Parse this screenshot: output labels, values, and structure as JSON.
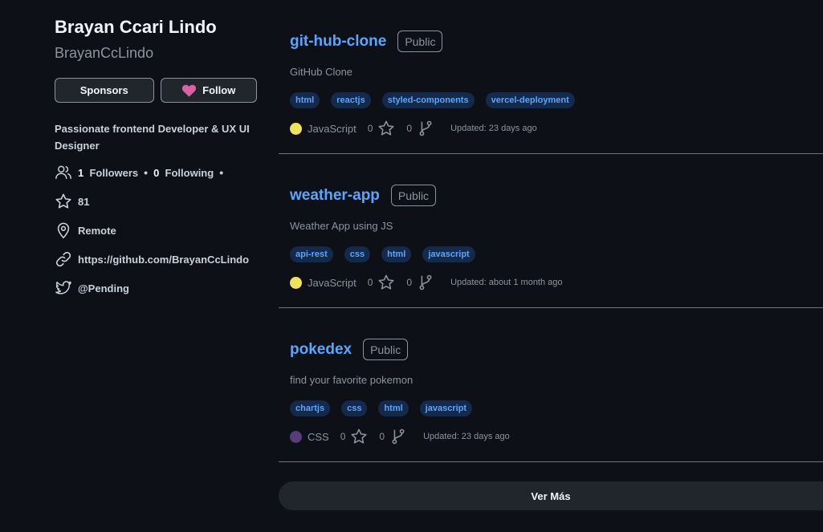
{
  "profile": {
    "name": "Brayan Ccari Lindo",
    "login": "BrayanCcLindo",
    "sponsors_label": "Sponsors",
    "follow_label": "Follow",
    "bio": "Passionate frontend Developer & UX UI Designer",
    "followers_count": "1",
    "followers_label": "Followers",
    "following_count": "0",
    "following_label": "Following",
    "separator": "•",
    "stars": "81",
    "location": "Remote",
    "website": "https://github.com/BrayanCcLindo",
    "twitter": "@Pending",
    "heart_color": "#db61a2"
  },
  "repos": [
    {
      "name": "git-hub-clone",
      "visibility": "Public",
      "description": "GitHub Clone",
      "topics": [
        "html",
        "reactjs",
        "styled-components",
        "vercel-deployment"
      ],
      "language": "JavaScript",
      "language_color": "#f1e05a",
      "stars": "0",
      "forks": "0",
      "updated": "Updated: 23 days ago"
    },
    {
      "name": "weather-app",
      "visibility": "Public",
      "description": "Weather App using JS",
      "topics": [
        "api-rest",
        "css",
        "html",
        "javascript"
      ],
      "language": "JavaScript",
      "language_color": "#f1e05a",
      "stars": "0",
      "forks": "0",
      "updated": "Updated: about 1 month ago"
    },
    {
      "name": "pokedex",
      "visibility": "Public",
      "description": "find your favorite pokemon",
      "topics": [
        "chartjs",
        "css",
        "html",
        "javascript"
      ],
      "language": "CSS",
      "language_color": "#563d7c",
      "stars": "0",
      "forks": "0",
      "updated": "Updated: 23 days ago"
    }
  ],
  "more_label": "Ver Más",
  "colors": {
    "background": "#0d1117",
    "accent_link": "#58a6ff",
    "topic_bg": "#15294a",
    "button_bg": "#21262d"
  }
}
